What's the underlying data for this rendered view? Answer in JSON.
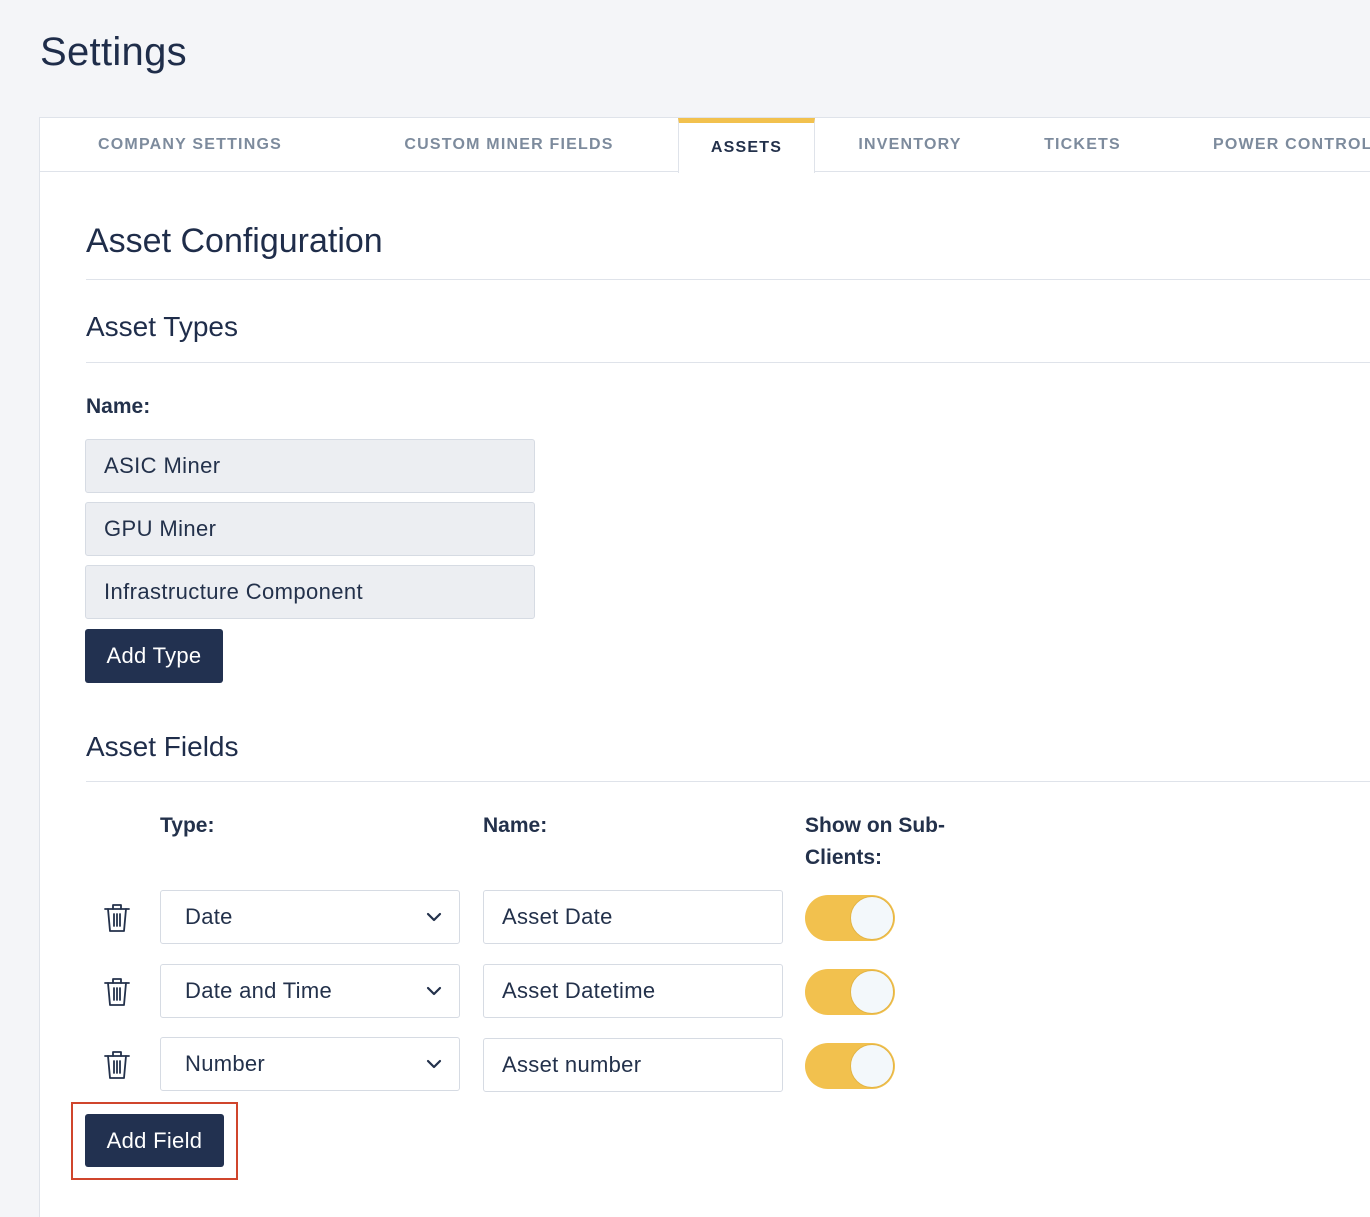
{
  "page": {
    "title": "Settings"
  },
  "tabs": [
    {
      "label": "COMPANY SETTINGS",
      "active": false
    },
    {
      "label": "CUSTOM MINER FIELDS",
      "active": false
    },
    {
      "label": "ASSETS",
      "active": true
    },
    {
      "label": "INVENTORY",
      "active": false
    },
    {
      "label": "TICKETS",
      "active": false
    },
    {
      "label": "POWER CONTROL",
      "active": false
    }
  ],
  "config": {
    "title": "Asset Configuration"
  },
  "asset_types": {
    "title": "Asset Types",
    "name_label": "Name:",
    "items": [
      "ASIC Miner",
      "GPU Miner",
      "Infrastructure Component"
    ],
    "add_button": "Add Type"
  },
  "asset_fields": {
    "title": "Asset Fields",
    "col_type": "Type:",
    "col_name": "Name:",
    "col_show": "Show on Sub-Clients:",
    "rows": [
      {
        "type": "Date",
        "name": "Asset Date",
        "show_on_subclients": true
      },
      {
        "type": "Date and Time",
        "name": "Asset Datetime",
        "show_on_subclients": true
      },
      {
        "type": "Number",
        "name": "Asset number",
        "show_on_subclients": true
      }
    ],
    "add_button": "Add Field"
  },
  "colors": {
    "accent": "#f2c14e",
    "primary_button": "#223150",
    "highlight": "#d0452c"
  },
  "icons": {
    "delete": "trash-icon",
    "dropdown": "chevron-down-icon"
  }
}
